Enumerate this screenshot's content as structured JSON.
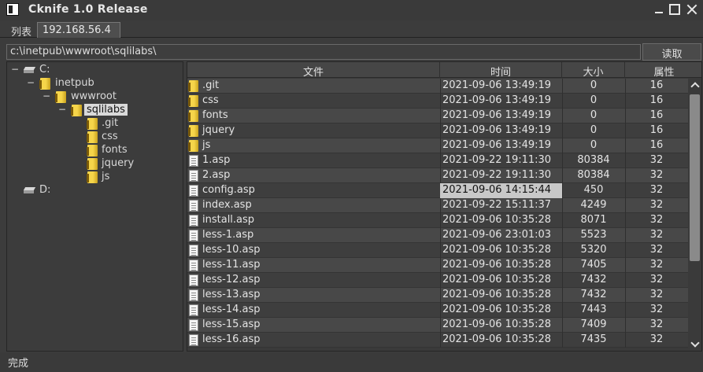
{
  "window": {
    "title": "Cknife 1.0 Release"
  },
  "tabs": [
    {
      "label": "列表"
    },
    {
      "label": "192.168.56.4"
    }
  ],
  "pathbar": {
    "value": "c:\\inetpub\\wwwroot\\sqlilabs\\",
    "read_button": "读取"
  },
  "tree": {
    "nodes": [
      {
        "label": "C:",
        "type": "drive",
        "expanded": true
      },
      {
        "label": "inetpub",
        "type": "folder",
        "expanded": true
      },
      {
        "label": "wwwroot",
        "type": "folder",
        "expanded": true
      },
      {
        "label": "sqlilabs",
        "type": "folder",
        "expanded": true,
        "selected": true
      },
      {
        "label": ".git",
        "type": "folder"
      },
      {
        "label": "css",
        "type": "folder"
      },
      {
        "label": "fonts",
        "type": "folder"
      },
      {
        "label": "jquery",
        "type": "folder"
      },
      {
        "label": "js",
        "type": "folder"
      },
      {
        "label": "D:",
        "type": "drive"
      }
    ],
    "toggle_symbol": "−"
  },
  "table": {
    "headers": {
      "name": "文件",
      "time": "时间",
      "size": "大小",
      "attr": "属性"
    },
    "rows": [
      {
        "icon": "folder-icon",
        "name": ".git",
        "time": "2021-09-06 13:49:19",
        "size": "0",
        "attr": "16"
      },
      {
        "icon": "folder-icon",
        "name": "css",
        "time": "2021-09-06 13:49:19",
        "size": "0",
        "attr": "16"
      },
      {
        "icon": "folder-icon",
        "name": "fonts",
        "time": "2021-09-06 13:49:19",
        "size": "0",
        "attr": "16"
      },
      {
        "icon": "folder-icon",
        "name": "jquery",
        "time": "2021-09-06 13:49:19",
        "size": "0",
        "attr": "16"
      },
      {
        "icon": "folder-icon",
        "name": "js",
        "time": "2021-09-06 13:49:19",
        "size": "0",
        "attr": "16"
      },
      {
        "icon": "file-icon",
        "name": "1.asp",
        "time": "2021-09-22 19:11:30",
        "size": "80384",
        "attr": "32"
      },
      {
        "icon": "file-icon",
        "name": "2.asp",
        "time": "2021-09-22 19:11:30",
        "size": "80384",
        "attr": "32"
      },
      {
        "icon": "file-icon",
        "name": "config.asp",
        "time": "2021-09-06 14:15:44",
        "size": "450",
        "attr": "32",
        "highlight_time": true
      },
      {
        "icon": "file-icon",
        "name": "index.asp",
        "time": "2021-09-22 15:11:37",
        "size": "4249",
        "attr": "32"
      },
      {
        "icon": "file-icon",
        "name": "install.asp",
        "time": "2021-09-06 10:35:28",
        "size": "8071",
        "attr": "32"
      },
      {
        "icon": "file-icon",
        "name": "less-1.asp",
        "time": "2021-09-06 23:01:03",
        "size": "5523",
        "attr": "32"
      },
      {
        "icon": "file-icon",
        "name": "less-10.asp",
        "time": "2021-09-06 10:35:28",
        "size": "5320",
        "attr": "32"
      },
      {
        "icon": "file-icon",
        "name": "less-11.asp",
        "time": "2021-09-06 10:35:28",
        "size": "7405",
        "attr": "32"
      },
      {
        "icon": "file-icon",
        "name": "less-12.asp",
        "time": "2021-09-06 10:35:28",
        "size": "7432",
        "attr": "32"
      },
      {
        "icon": "file-icon",
        "name": "less-13.asp",
        "time": "2021-09-06 10:35:28",
        "size": "7432",
        "attr": "32"
      },
      {
        "icon": "file-icon",
        "name": "less-14.asp",
        "time": "2021-09-06 10:35:28",
        "size": "7443",
        "attr": "32"
      },
      {
        "icon": "file-icon",
        "name": "less-15.asp",
        "time": "2021-09-06 10:35:28",
        "size": "7409",
        "attr": "32"
      },
      {
        "icon": "file-icon",
        "name": "less-16.asp",
        "time": "2021-09-06 10:35:28",
        "size": "7435",
        "attr": "32"
      }
    ]
  },
  "statusbar": {
    "text": "完成"
  }
}
